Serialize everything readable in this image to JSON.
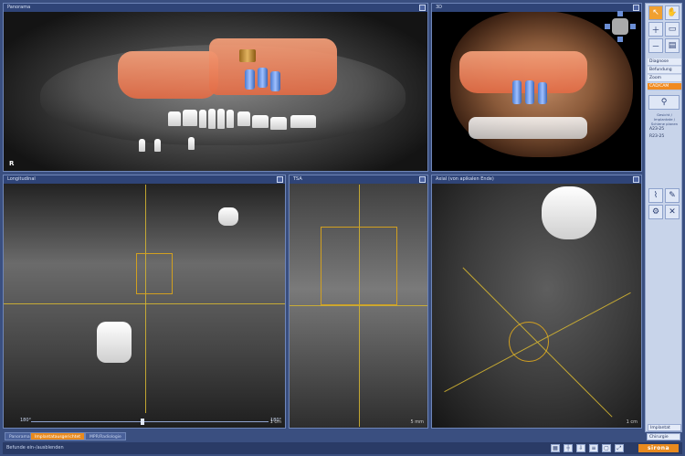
{
  "panes": {
    "panorama": {
      "title": "Panorama",
      "corner_label": "R"
    },
    "view3d": {
      "title": "3D"
    },
    "longitudinal": {
      "title": "Longitudinal",
      "scale": "1 cm",
      "slider_left": "180°",
      "slider_right": "180°"
    },
    "cross": {
      "title": "TSA",
      "scale": "5 mm"
    },
    "axial": {
      "title": "Axial (von apikalen Ende)",
      "scale": "1 cm"
    }
  },
  "toolbar": {
    "menu": [
      "Diagnose",
      "Befundung",
      "Zoom",
      "CAD/CAM"
    ],
    "active_menu": "CAD/CAM",
    "section_label": "Gesicht / Implantate / Schiene planen",
    "implants": [
      "A23-25",
      "R23-25"
    ],
    "bottom_buttons": [
      "Implantat",
      "Chirurgie"
    ]
  },
  "tabs": [
    {
      "label": "Panorama",
      "active": false
    },
    {
      "label": "Implantatausgerichtet",
      "active": true
    },
    {
      "label": "MPR/Radiologie",
      "active": false
    }
  ],
  "status": {
    "text": "Befunde ein-/ausblenden"
  },
  "brand": "sirona",
  "colors": {
    "accent": "#e88a1e",
    "chrome": "#3a4f80",
    "guide": "#d2b232",
    "implant": "#4b7bd1",
    "crown": "#e26b45"
  },
  "icons": [
    "pointer-icon",
    "hand-icon",
    "zoom-in-icon",
    "zoom-out-icon",
    "layout-icon",
    "print-icon",
    "implant-tool-icon",
    "nerve-tool-icon",
    "delete-icon"
  ]
}
